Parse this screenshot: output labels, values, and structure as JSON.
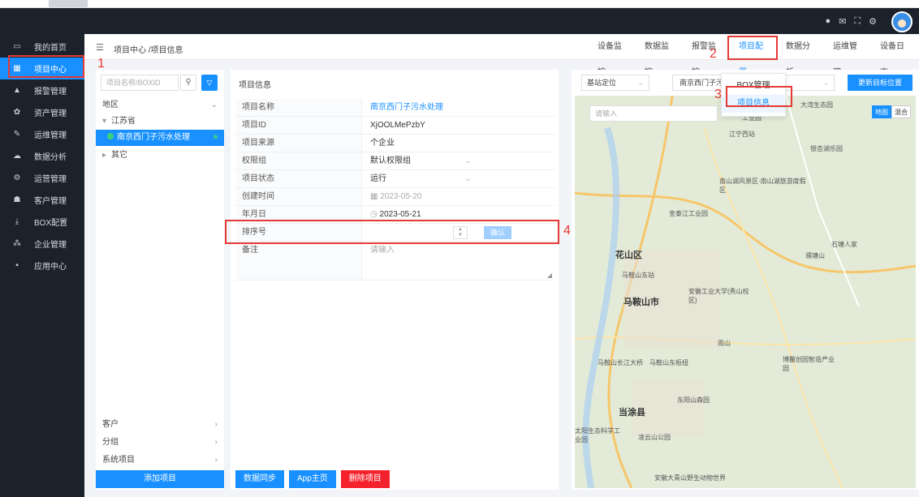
{
  "sidebar": {
    "items": [
      {
        "icon": "monitor-icon",
        "glyph": "▭",
        "label": "我的首页"
      },
      {
        "icon": "project-icon",
        "glyph": "▦",
        "label": "项目中心"
      },
      {
        "icon": "bell-icon",
        "glyph": "▲",
        "label": "报警管理"
      },
      {
        "icon": "asset-icon",
        "glyph": "✿",
        "label": "资产管理"
      },
      {
        "icon": "wrench-icon",
        "glyph": "✎",
        "label": "运维管理"
      },
      {
        "icon": "cloud-icon",
        "glyph": "☁",
        "label": "数据分析"
      },
      {
        "icon": "gears-icon",
        "glyph": "⚙",
        "label": "运营管理"
      },
      {
        "icon": "user-icon",
        "glyph": "☗",
        "label": "客户管理"
      },
      {
        "icon": "download-icon",
        "glyph": "⤓",
        "label": "BOX配置"
      },
      {
        "icon": "org-icon",
        "glyph": "⁂",
        "label": "企业管理"
      },
      {
        "icon": "grid-icon",
        "glyph": "▪",
        "label": "应用中心"
      }
    ]
  },
  "header": {
    "breadcrumb": "项目中心 /项目信息",
    "nav": [
      "设备监控",
      "数据监控",
      "报警监控",
      "项目配置",
      "数据分析",
      "运维管理",
      "设备日志"
    ]
  },
  "dropdown": {
    "items": [
      "BOX管理",
      "项目信息"
    ]
  },
  "left": {
    "search_placeholder": "项目名称/BOXID",
    "tree": {
      "region": "地区",
      "province": "江苏省",
      "project": "南京西门子污水处理",
      "other": "其它"
    },
    "bottom": [
      "客户",
      "分组",
      "系统项目"
    ],
    "add_button": "添加项目"
  },
  "center": {
    "title": "项目信息",
    "fields": {
      "name_label": "项目名称",
      "name_value": "南京西门子污水处理",
      "id_label": "项目ID",
      "id_value": "XjOOLMePzbY",
      "source_label": "项目来源",
      "source_value": "个企业",
      "perm_label": "权限组",
      "perm_value": "默认权限组",
      "status_label": "项目状态",
      "status_value": "运行",
      "created_label": "创建时间",
      "created_value": "2023-05-20",
      "ymd_label": "年月日",
      "ymd_value": "2023-05-21",
      "sort_label": "排序号",
      "confirm": "确认",
      "note_label": "备注",
      "note_placeholder": "请输入"
    },
    "buttons": [
      "数据同步",
      "App主页",
      "删除项目"
    ]
  },
  "right": {
    "select1": "基站定位",
    "select2": "南京西门子污水",
    "update": "更新目标位置",
    "map_search": "请输入",
    "toggle": [
      "地图",
      "混合"
    ],
    "places": [
      "工业园",
      "大湾生态园",
      "江宁西站",
      "银杏湖乐园",
      "南山湖风景区·南山湖旅游度假区",
      "金泰江工业园",
      "花山区",
      "马鞍山市",
      "马鞍山东站",
      "安徽工业大学(秀山校区)",
      "石塘人家",
      "濮塘山",
      "雨山",
      "东阳山森园",
      "当涂县",
      "太阳生态科学工业园",
      "凌云山公园",
      "安徽大青山野生动物世界",
      "马鞍山长江大桥",
      "马鞍山东枢纽",
      "博鳌创园智造产业园"
    ]
  },
  "callouts": [
    "1",
    "2",
    "3",
    "4"
  ]
}
